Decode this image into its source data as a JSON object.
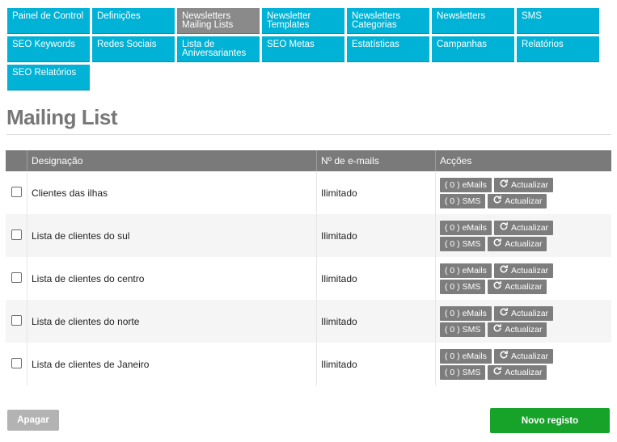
{
  "nav": {
    "items": [
      {
        "label": "Painel de Control",
        "active": false
      },
      {
        "label": "Definições",
        "active": false
      },
      {
        "label": "Newsletters Mailing Lists",
        "active": true
      },
      {
        "label": "Newsletter Templates",
        "active": false
      },
      {
        "label": "Newsletters Categorias",
        "active": false
      },
      {
        "label": "Newsletters",
        "active": false
      },
      {
        "label": "SMS",
        "active": false
      },
      {
        "label": "SEO Keywords",
        "active": false
      },
      {
        "label": "Redes Sociais",
        "active": false
      },
      {
        "label": "Lista de Aniversariantes",
        "active": false
      },
      {
        "label": "SEO Metas",
        "active": false
      },
      {
        "label": "Estatísticas",
        "active": false
      },
      {
        "label": "Campanhas",
        "active": false
      },
      {
        "label": "Relatórios",
        "active": false
      },
      {
        "label": "SEO Relatórios",
        "active": false
      }
    ]
  },
  "page": {
    "title": "Mailing List"
  },
  "table": {
    "headers": {
      "name": "Designação",
      "count": "Nº de e-mails",
      "actions": "Acções"
    },
    "rows": [
      {
        "name": "Clientes das ilhas",
        "count": "Ilimitado"
      },
      {
        "name": "Lista de clientes do sul",
        "count": "Ilimitado"
      },
      {
        "name": "Lista de clientes do centro",
        "count": "Ilimitado"
      },
      {
        "name": "Lista de clientes do norte",
        "count": "Ilimitado"
      },
      {
        "name": "Lista de clientes de Janeiro",
        "count": "Ilimitado"
      }
    ],
    "actions": {
      "emails_label": "( 0 ) eMails",
      "sms_label": "( 0 ) SMS",
      "update_label": "Actualizar"
    }
  },
  "footer": {
    "delete_label": "Apagar",
    "new_label": "Novo registo"
  },
  "colors": {
    "nav_accent": "#00b3d6",
    "nav_active": "#8a8a8a",
    "primary_button": "#17a32a",
    "header_bg": "#7a7a7a"
  }
}
